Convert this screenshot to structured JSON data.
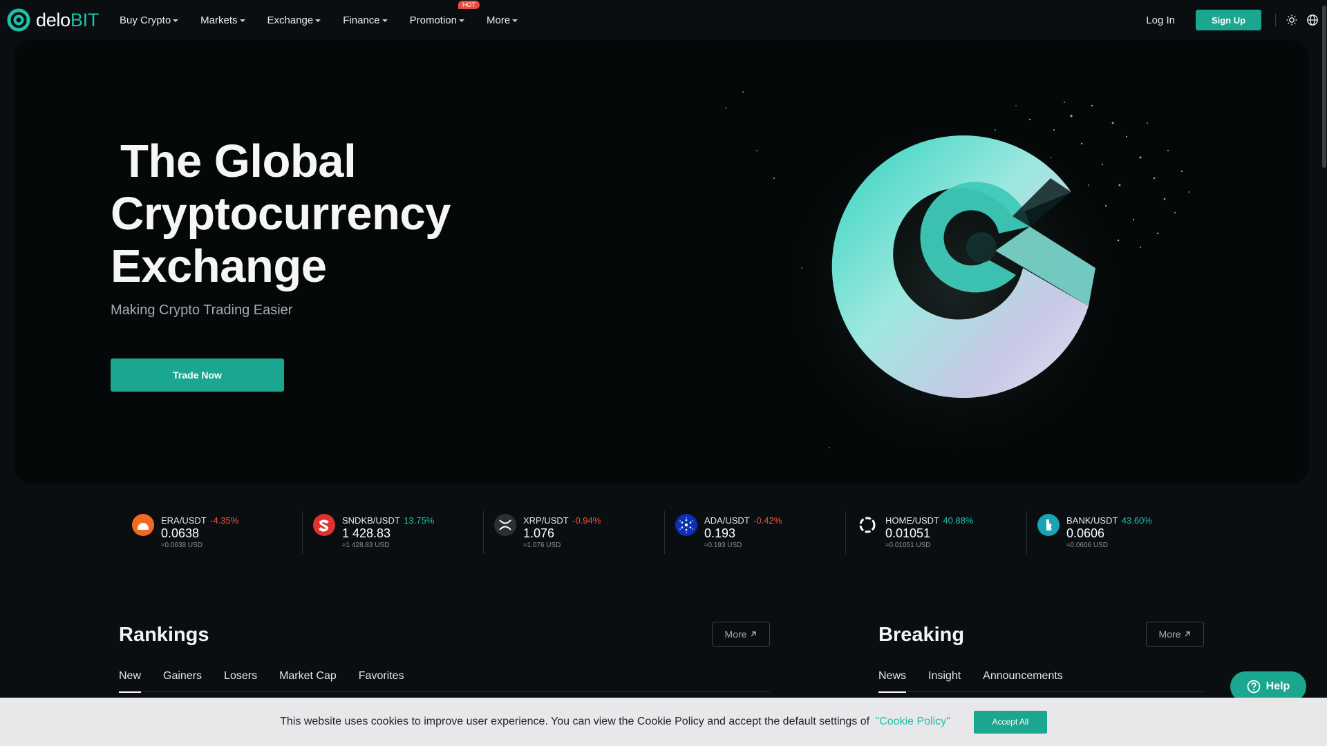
{
  "brand": {
    "name_part1": "delo",
    "name_part2": "BIT",
    "accent_color": "#1aa68f"
  },
  "nav": {
    "items": [
      {
        "label": "Buy Crypto"
      },
      {
        "label": "Markets"
      },
      {
        "label": "Exchange"
      },
      {
        "label": "Finance"
      },
      {
        "label": "Promotion",
        "badge": "HOT"
      },
      {
        "label": "More"
      }
    ],
    "login": "Log In",
    "signup": "Sign Up",
    "icons": [
      "theme-sun-icon",
      "globe-language-icon"
    ]
  },
  "hero": {
    "title_line1": "The Global",
    "title_line2": "Cryptocurrency",
    "title_line3": "Exchange",
    "subtitle": "Making Crypto Trading Easier",
    "cta": "Trade Now"
  },
  "tickers": [
    {
      "pair": "ERA/USDT",
      "change": "-4.35%",
      "direction": "down",
      "price": "0.0638",
      "usd": "≈0.0638 USD",
      "icon": "era-coin-icon",
      "color": "#f26a21"
    },
    {
      "pair": "SNDKB/USDT",
      "change": "13.75%",
      "direction": "up",
      "price": "1 428.83",
      "usd": "≈1 428.83 USD",
      "icon": "sndkb-coin-icon",
      "color": "#e0322f"
    },
    {
      "pair": "XRP/USDT",
      "change": "-0.94%",
      "direction": "down",
      "price": "1.076",
      "usd": "≈1.076 USD",
      "icon": "xrp-coin-icon",
      "color": "#2b2f33"
    },
    {
      "pair": "ADA/USDT",
      "change": "-0.42%",
      "direction": "down",
      "price": "0.193",
      "usd": "≈0.193 USD",
      "icon": "ada-coin-icon",
      "color": "#0d2fb5"
    },
    {
      "pair": "HOME/USDT",
      "change": "40.88%",
      "direction": "up",
      "price": "0.01051",
      "usd": "≈0.01051 USD",
      "icon": "home-coin-icon",
      "color": "#ffffff"
    },
    {
      "pair": "BANK/USDT",
      "change": "43.60%",
      "direction": "up",
      "price": "0.0606",
      "usd": "≈0.0606 USD",
      "icon": "bank-coin-icon",
      "color": "#1aa3b5"
    }
  ],
  "rankings": {
    "title": "Rankings",
    "more": "More",
    "tabs": [
      "New",
      "Gainers",
      "Losers",
      "Market Cap",
      "Favorites"
    ],
    "active_tab": "New"
  },
  "breaking": {
    "title": "Breaking",
    "more": "More",
    "tabs": [
      "News",
      "Insight",
      "Announcements"
    ],
    "active_tab": "News"
  },
  "cookie": {
    "text": "This website uses cookies to improve user experience. You can view the Cookie Policy and accept the default settings of",
    "link": "\"Cookie Policy\"",
    "accept": "Accept All"
  },
  "help": {
    "label": "Help"
  }
}
